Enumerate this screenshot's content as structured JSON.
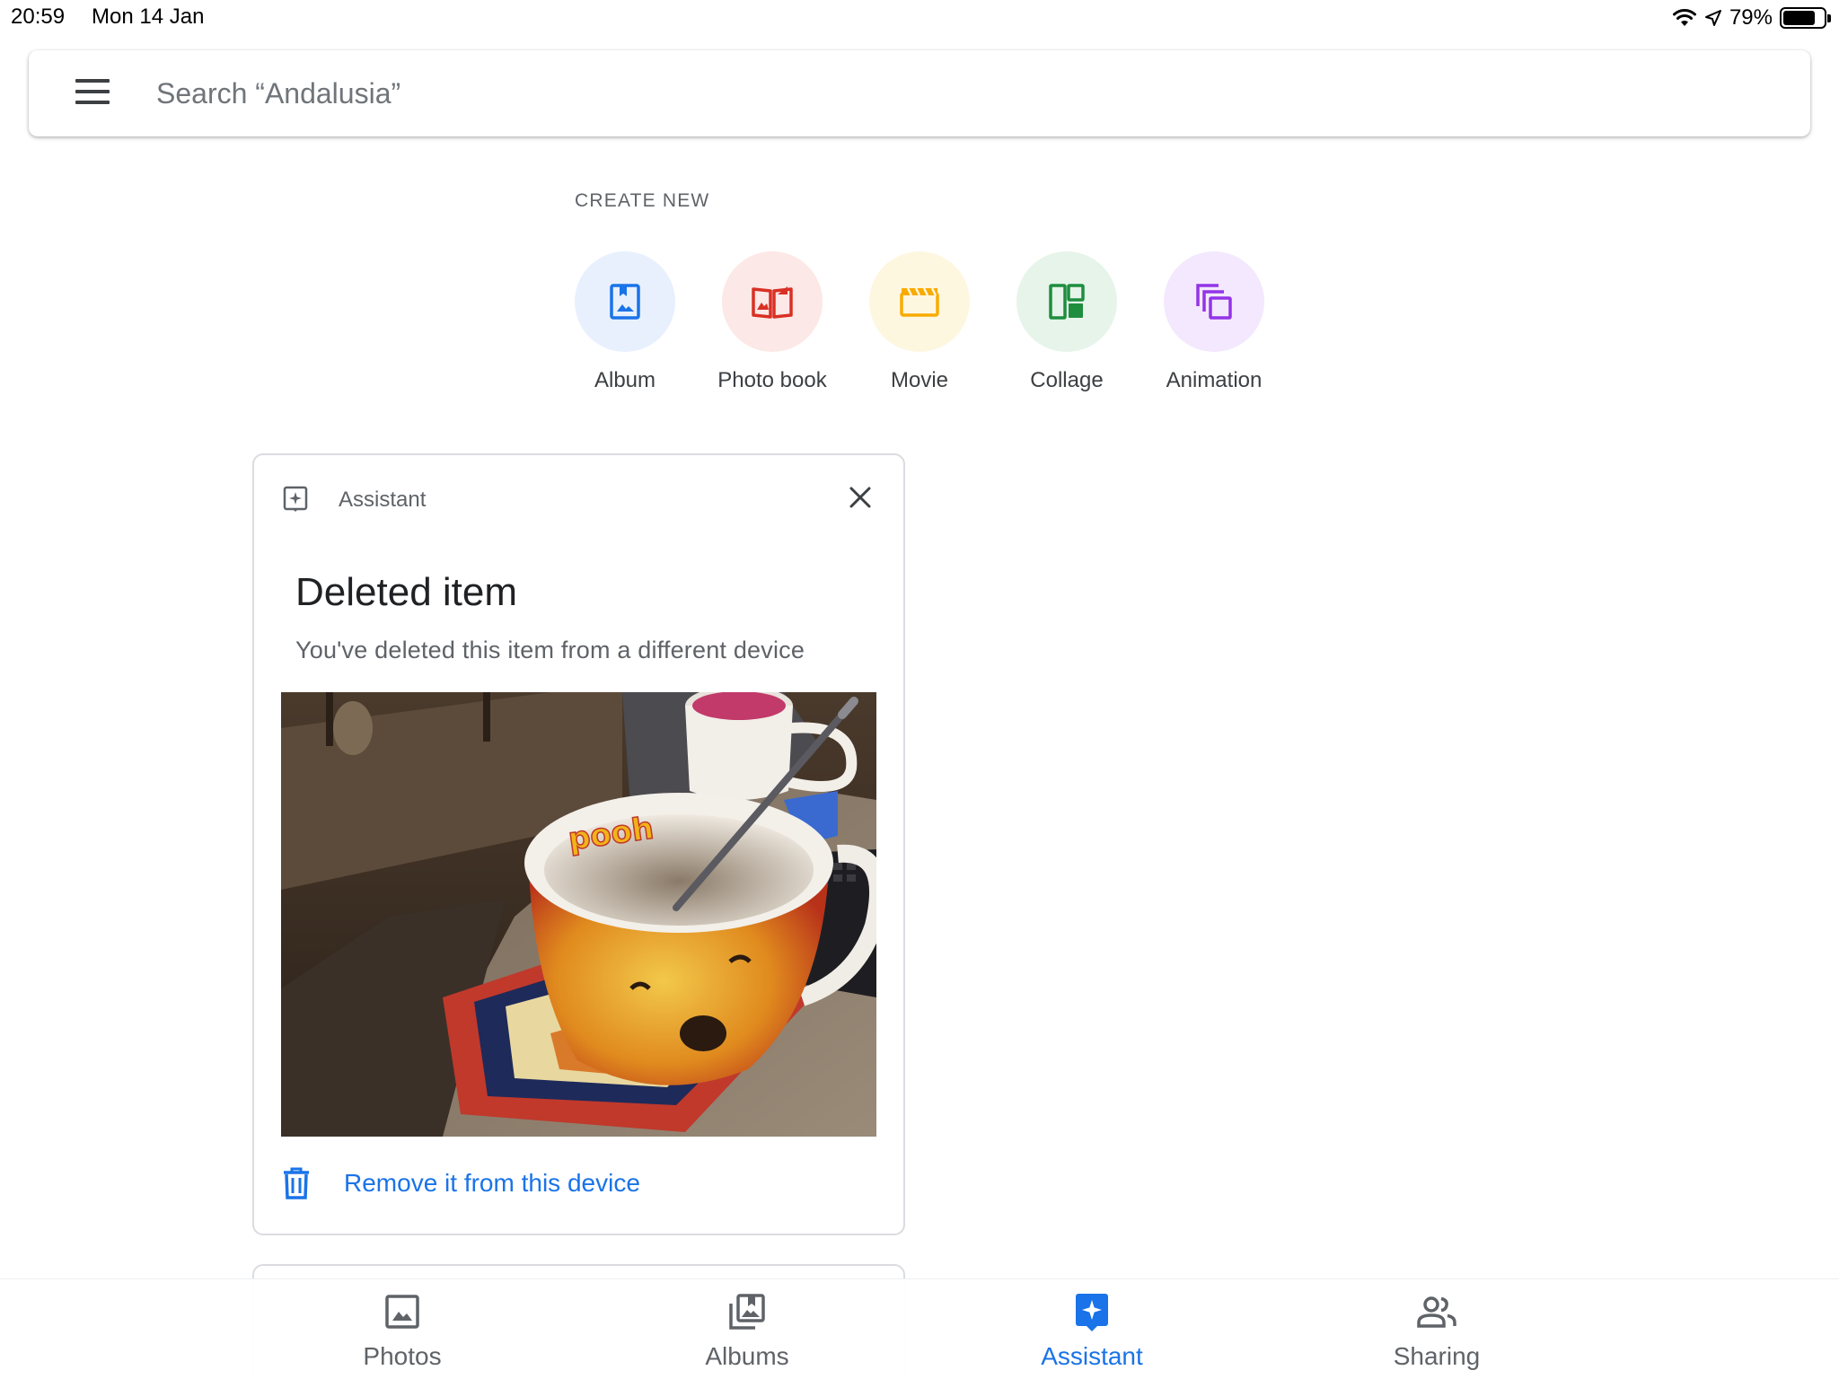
{
  "status_bar": {
    "time": "20:59",
    "date": "Mon 14 Jan",
    "battery": "79%",
    "battery_level": 0.79,
    "icons": [
      "wifi-icon",
      "location-arrow-icon",
      "battery-icon"
    ]
  },
  "search": {
    "placeholder": "Search “Andalusia”",
    "menu_icon": "menu-icon"
  },
  "create_new": {
    "heading": "CREATE NEW",
    "items": [
      {
        "label": "Album",
        "icon": "album-icon",
        "color": "#1a73e8",
        "bg": "#e8f0fe"
      },
      {
        "label": "Photo book",
        "icon": "photo-book-icon",
        "color": "#d93025",
        "bg": "#fce8e6"
      },
      {
        "label": "Movie",
        "icon": "movie-icon",
        "color": "#f9ab00",
        "bg": "#fef7e0"
      },
      {
        "label": "Collage",
        "icon": "collage-icon",
        "color": "#1e8e3e",
        "bg": "#e6f4ea"
      },
      {
        "label": "Animation",
        "icon": "animation-icon",
        "color": "#9334e6",
        "bg": "#f3e8fd"
      }
    ]
  },
  "card": {
    "header_label": "Assistant",
    "title": "Deleted item",
    "subtitle": "You've deleted this item from a different device",
    "photo_alt": "Winnie the Pooh mug on a coaster",
    "photo_mug_text": "pooh",
    "action_label": "Remove it from this device",
    "action_icon": "trash-icon"
  },
  "bottom_nav": {
    "items": [
      {
        "label": "Photos",
        "icon": "photos-icon",
        "active": false
      },
      {
        "label": "Albums",
        "icon": "albums-icon",
        "active": false
      },
      {
        "label": "Assistant",
        "icon": "assistant-icon",
        "active": true
      },
      {
        "label": "Sharing",
        "icon": "sharing-icon",
        "active": false
      }
    ]
  },
  "colors": {
    "accent": "#1a73e8",
    "text_primary": "#202124",
    "text_secondary": "#5f6368"
  }
}
